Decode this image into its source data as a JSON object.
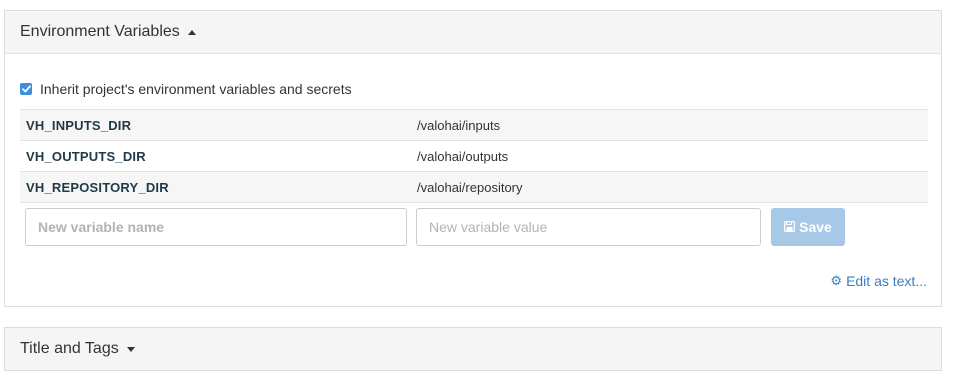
{
  "env_panel": {
    "heading": "Environment Variables",
    "inherit_checked": true,
    "inherit_label": "Inherit project's environment variables and secrets",
    "variables": [
      {
        "name": "VH_INPUTS_DIR",
        "value": "/valohai/inputs"
      },
      {
        "name": "VH_OUTPUTS_DIR",
        "value": "/valohai/outputs"
      },
      {
        "name": "VH_REPOSITORY_DIR",
        "value": "/valohai/repository"
      }
    ],
    "new_name_placeholder": "New variable name",
    "new_value_placeholder": "New variable value",
    "save_label": "Save",
    "edit_as_text_label": "Edit as text..."
  },
  "title_panel": {
    "heading": "Title and Tags"
  },
  "colors": {
    "accent": "#3c8fde",
    "save_disabled": "#a7c8e6",
    "link": "#3a7fbf"
  },
  "icons": {
    "env_caret": "caret-up-icon",
    "title_caret": "caret-down-icon",
    "checkbox": "checkmark-icon",
    "save": "floppy-disk-icon",
    "edit": "gear-icon"
  }
}
